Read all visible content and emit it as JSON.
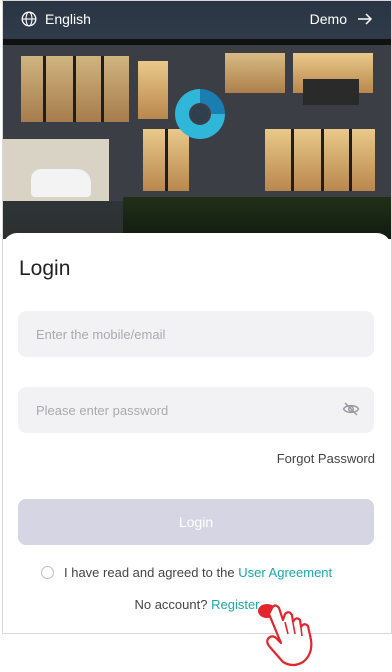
{
  "header": {
    "language": "English",
    "demo_label": "Demo"
  },
  "login": {
    "title": "Login",
    "account_placeholder": "Enter the mobile/email",
    "password_placeholder": "Please enter password",
    "forgot_password": "Forgot Password",
    "login_button": "Login",
    "agreement_text": "I have read and agreed to the",
    "agreement_link": "User Agreement",
    "no_account": "No account?",
    "register_link": "Register"
  },
  "icons": {
    "language": "globe-icon",
    "demo": "arrow-right-icon",
    "password_visibility": "eye-off-icon",
    "pointer": "hand-pointer-icon"
  },
  "colors": {
    "accent": "#1aa6a6",
    "button_disabled": "#d5d5e3",
    "field_bg": "#f2f2f5"
  }
}
